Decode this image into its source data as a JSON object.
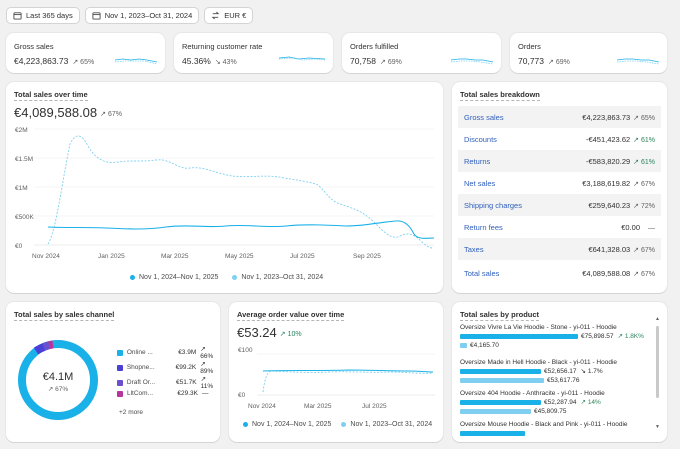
{
  "filters": {
    "period": "Last 365 days",
    "date_range": "Nov 1, 2023–Oct 31, 2024",
    "currency": "EUR €"
  },
  "kpis": [
    {
      "title": "Gross sales",
      "value": "€4,223,863.73",
      "delta": "65%"
    },
    {
      "title": "Returning customer rate",
      "value": "45.36%",
      "delta": "43%"
    },
    {
      "title": "Orders fulfilled",
      "value": "70,758",
      "delta": "69%"
    },
    {
      "title": "Orders",
      "value": "70,773",
      "delta": "69%"
    }
  ],
  "sales_over_time": {
    "title": "Total sales over time",
    "value": "€4,089,588.08",
    "delta": "67%",
    "legend": [
      "Nov 1, 2024–Nov 1, 2025",
      "Nov 1, 2023–Oct 31, 2024"
    ],
    "y_ticks": [
      "€2M",
      "€1.5M",
      "€1M",
      "€500K",
      "€0"
    ],
    "x_ticks": [
      "Nov 2024",
      "Jan 2025",
      "Mar 2025",
      "May 2025",
      "Jul 2025",
      "Sep 2025"
    ]
  },
  "breakdown": {
    "title": "Total sales breakdown",
    "rows": [
      {
        "label": "Gross sales",
        "value": "€4,223,863.73",
        "delta": "65%",
        "up": false
      },
      {
        "label": "Discounts",
        "value": "-€451,423.62",
        "delta": "61%",
        "up": true
      },
      {
        "label": "Returns",
        "value": "-€583,820.29",
        "delta": "61%",
        "up": true
      },
      {
        "label": "Net sales",
        "value": "€3,188,619.82",
        "delta": "67%",
        "up": false
      },
      {
        "label": "Shipping charges",
        "value": "€259,640.23",
        "delta": "72%",
        "up": false
      },
      {
        "label": "Return fees",
        "value": "€0.00",
        "delta": "—",
        "up": false
      },
      {
        "label": "Taxes",
        "value": "€641,328.03",
        "delta": "67%",
        "up": false
      },
      {
        "label": "Total sales",
        "value": "€4,089,588.08",
        "delta": "67%",
        "up": false
      }
    ]
  },
  "channels": {
    "title": "Total sales by sales channel",
    "center_value": "€4.1M",
    "center_delta": "67%",
    "items": [
      {
        "label": "Online ...",
        "value": "€3.9M",
        "delta": "66%",
        "color": "#1ab0e8"
      },
      {
        "label": "Shopne...",
        "value": "€99.2K",
        "delta": "89%",
        "color": "#4a3fd6"
      },
      {
        "label": "Draft Or...",
        "value": "€51.7K",
        "delta": "11%",
        "color": "#6b4fd0"
      },
      {
        "label": "LltCom...",
        "value": "€29.3K",
        "delta": "—",
        "color": "#b6359c"
      }
    ],
    "more": "+2 more"
  },
  "aov": {
    "title": "Average order value over time",
    "value": "€53.24",
    "delta": "10%",
    "y_ticks": [
      "€100",
      "€0"
    ],
    "x_ticks": [
      "Nov 2024",
      "Mar 2025",
      "Jul 2025"
    ],
    "legend": [
      "Nov 1, 2024–Nov 1, 2025",
      "Nov 1, 2023–Oct 31, 2024"
    ]
  },
  "products": {
    "title": "Total sales by product",
    "items": [
      {
        "name": "Oversize Vivre La Vie Hoodie - Stone - yi-011 - Hoodie",
        "current": "€75,898.57",
        "previous": "€4,165.70",
        "delta": "1.8K%",
        "cur_frac": 1.0,
        "prev_frac": 0.055
      },
      {
        "name": "Oversize Made in Hell Hoodie - Black - yi-011 - Hoodie",
        "current": "€52,656.17",
        "previous": "€53,617.76",
        "delta": "1.7%",
        "cur_frac": 0.69,
        "prev_frac": 0.71
      },
      {
        "name": "Oversize 404 Hoodie - Anthracite - yi-011 - Hoodie",
        "current": "€52,287.94",
        "previous": "€45,809.75",
        "delta": "14%",
        "cur_frac": 0.69,
        "prev_frac": 0.6
      },
      {
        "name": "Oversize Mouse Hoodie - Black and Pink - yi-011 - Hoodie",
        "current": "",
        "previous": "",
        "delta": "",
        "cur_frac": 0.55,
        "prev_frac": 0
      }
    ]
  },
  "colors": {
    "current_series": "#1ab0e8",
    "previous_series": "#7fd0f0",
    "accent_link": "#2f5fbc",
    "positive": "#29845a"
  }
}
